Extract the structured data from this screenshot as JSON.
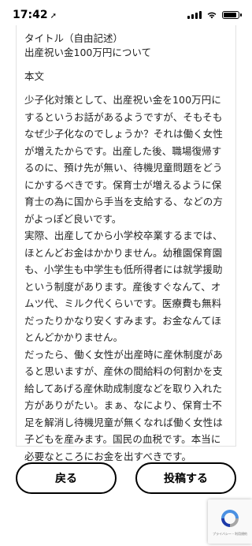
{
  "status_bar": {
    "time": "17:42",
    "location_arrow": "➚",
    "signal_icon": "signal-bars",
    "wifi_icon": "wifi",
    "battery_icon": "battery"
  },
  "form": {
    "title_label": "タイトル（自由記述）",
    "title_value": "出産祝い金100万円について",
    "body_label": "本文",
    "body_value": "少子化対策として、出産祝い金を100万円にするというお話があるようですが、そもそもなぜ少子化なのでしょうか？それは働く女性が増えたからです。出産した後、職場復帰するのに、預け先が無い、待機児童問題をどうにかするべきです。保育士が増えるように保育士の為に国から手当を支給する、などの方がよっぽど良いです。\n実際、出産してから小学校卒業するまでは、ほとんどお金はかかりません。幼稚園保育園も、小学生も中学生も低所得者には就学援助という制度があります。産後すぐなんて、オムツ代、ミルク代くらいです。医療費も無料だったりかなり安くすみます。お金なんてほとんどかかりません。\nだったら、働く女性が出産時に産休制度があると思いますが、産休の間給料の何割かを支給してあげる産休助成制度などを取り入れた方がありがたい。まぁ、なにより、保育士不足を解消し待機児童が無くなれば働く女性は子どもを産みます。国民の血税です。本当に必要なところにお金を出すべきです。"
  },
  "buttons": {
    "back_label": "戻る",
    "submit_label": "投稿する"
  },
  "recaptcha": {
    "footer": "プライバシー・利用規約"
  }
}
